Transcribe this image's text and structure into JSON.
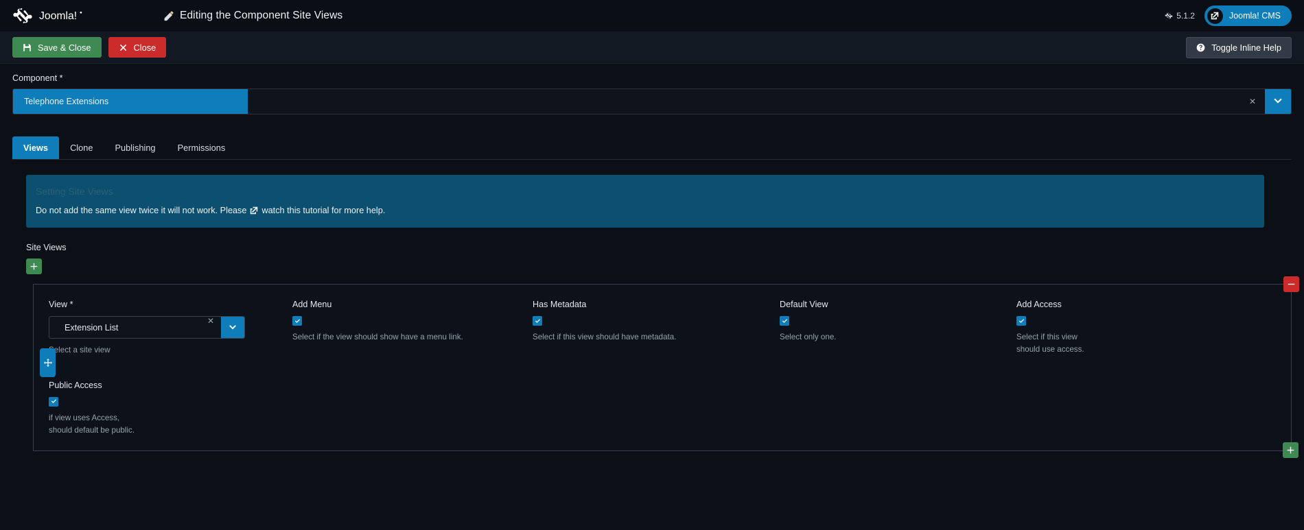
{
  "header": {
    "brand_name": "Joomla!",
    "title": "Editing the Component Site Views",
    "version": "5.1.2",
    "cms_button": "Joomla! CMS"
  },
  "toolbar": {
    "save_close": "Save & Close",
    "close": "Close",
    "toggle_help": "Toggle Inline Help"
  },
  "component_field": {
    "label": "Component *",
    "selected": "Telephone Extensions"
  },
  "tabs": [
    {
      "label": "Views",
      "active": true
    },
    {
      "label": "Clone",
      "active": false
    },
    {
      "label": "Publishing",
      "active": false
    },
    {
      "label": "Permissions",
      "active": false
    }
  ],
  "alert": {
    "title": "Setting Site Views",
    "text": "Do not add the same view twice it will not work. Please",
    "link_text": "watch this tutorial for more help."
  },
  "subform": {
    "label": "Site Views",
    "row": {
      "view": {
        "label": "View *",
        "value": "Extension List",
        "help": "Select a site view"
      },
      "add_menu": {
        "label": "Add Menu",
        "checked": true,
        "help": "Select if the view should show have a menu link."
      },
      "has_metadata": {
        "label": "Has Metadata",
        "checked": true,
        "help": "Select if this view should have metadata."
      },
      "default_view": {
        "label": "Default View",
        "checked": true,
        "help": "Select only one."
      },
      "add_access": {
        "label": "Add Access",
        "checked": true,
        "help_line1": "Select if this view",
        "help_line2": "should use access."
      },
      "public_access": {
        "label": "Public Access",
        "checked": true,
        "help_line1": "if view uses Access,",
        "help_line2": "should default be public."
      }
    }
  },
  "colors": {
    "accent": "#0e7dba",
    "success": "#3f8a53",
    "danger": "#cc2b2b",
    "background": "#0b0f16"
  }
}
